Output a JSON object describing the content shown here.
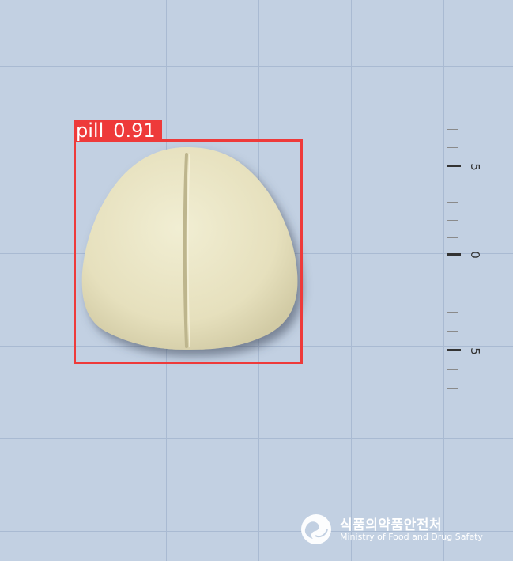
{
  "detection": {
    "label": "pill",
    "confidence": "0.91"
  },
  "ruler": {
    "labels": [
      "5",
      "0",
      "5"
    ]
  },
  "watermark": {
    "korean": "식품의약품안전처",
    "english": "Ministry of Food and Drug Safety"
  },
  "colors": {
    "background": "#c2d0e2",
    "grid": "#a9bad2",
    "pill": "#e9e4c2",
    "box": "#ee3a3a"
  }
}
